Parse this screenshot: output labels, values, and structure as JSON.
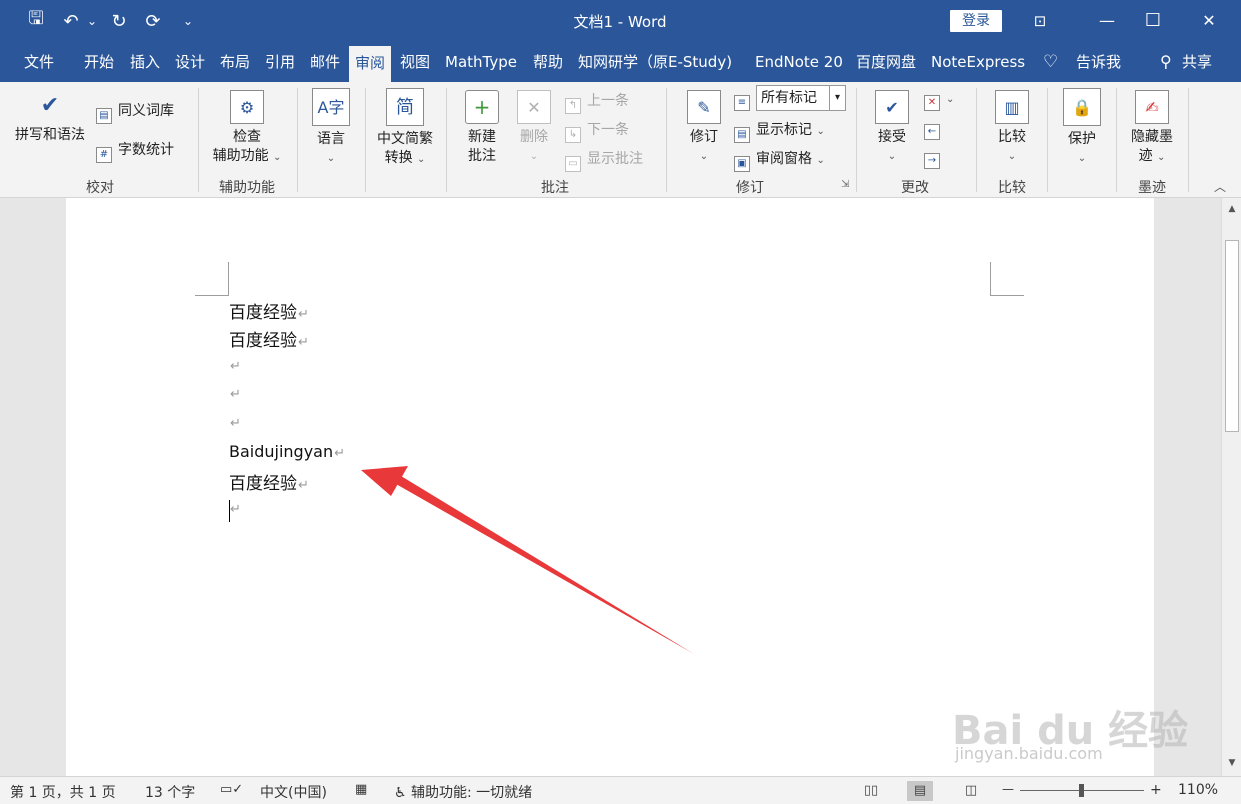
{
  "window": {
    "title": "文档1  -  Word",
    "login": "登录",
    "minimize": "—",
    "maximize": "☐",
    "close": "✕"
  },
  "quick_access": {
    "save": "🖫",
    "undo": "↶",
    "undo_dropdown": "⌄",
    "redo": "↻",
    "repeat": "⟳",
    "customize": "⌄"
  },
  "tabs": [
    "文件",
    "开始",
    "插入",
    "设计",
    "布局",
    "引用",
    "邮件",
    "审阅",
    "视图",
    "MathType",
    "帮助",
    "知网研学（原E-Study)",
    "EndNote 20",
    "百度网盘",
    "NoteExpress",
    "告诉我",
    "共享"
  ],
  "active_tab": "审阅",
  "ribbon": {
    "proofing": {
      "label": "校对",
      "spelling": "拼写和语法",
      "thesaurus": "同义词库",
      "word_count": "字数统计"
    },
    "accessibility": {
      "label": "辅助功能",
      "check_line1": "检查",
      "check_line2": "辅助功能"
    },
    "language": {
      "button": "语言"
    },
    "chinese": {
      "icon_char": "简",
      "line1": "中文简繁",
      "line2": "转换"
    },
    "comments": {
      "label": "批注",
      "new_line1": "新建",
      "new_line2": "批注",
      "delete": "删除",
      "previous": "上一条",
      "next": "下一条",
      "show": "显示批注"
    },
    "tracking": {
      "label": "修订",
      "track": "修订",
      "markup_value": "所有标记",
      "show_markup": "显示标记",
      "reviewing_pane": "审阅窗格"
    },
    "changes": {
      "label": "更改",
      "accept": "接受"
    },
    "compare": {
      "label": "比较",
      "button": "比较"
    },
    "protect": {
      "button": "保护"
    },
    "ink": {
      "label": "墨迹",
      "line1": "隐藏墨",
      "line2": "迹"
    }
  },
  "document": {
    "lines": [
      "百度经验",
      "百度经验",
      "",
      "",
      "",
      "Baidujingyan",
      "百度经验",
      ""
    ],
    "paragraph_mark": "↵"
  },
  "status": {
    "page": "第 1 页，共 1 页",
    "words": "13 个字",
    "language": "中文(中国)",
    "accessibility": "辅助功能: 一切就绪",
    "zoom_minus": "—",
    "zoom_plus": "+",
    "zoom": "110%"
  },
  "watermark": {
    "brand": "Bai du 经验",
    "url": "jingyan.baidu.com"
  },
  "colors": {
    "word_blue": "#2b579a",
    "arrow_red": "#e8383a"
  }
}
